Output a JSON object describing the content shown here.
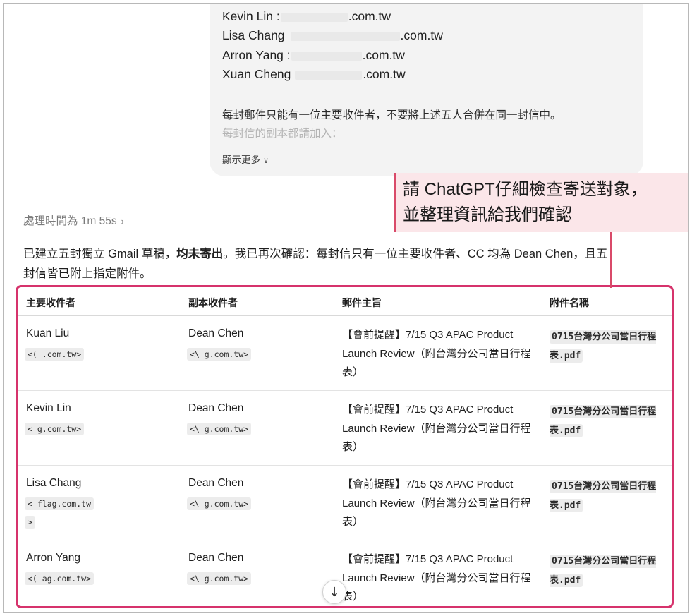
{
  "user_message": {
    "recipients": [
      {
        "name": "Kevin Lin :",
        "email_suffix": ".com.tw"
      },
      {
        "name": "Lisa Chang",
        "email_suffix": ".com.tw"
      },
      {
        "name": "Arron Yang :",
        "email_suffix": ".com.tw"
      },
      {
        "name": "Xuan Cheng",
        "email_suffix": ".com.tw"
      }
    ],
    "paragraph": "每封郵件只能有一位主要收件者，不要將上述五人合併在同一封信中。",
    "faded_line": "每封信的副本都請加入：",
    "show_more": "顯示更多",
    "show_more_icon": "chevron-down-icon"
  },
  "annotation": {
    "line1": "請 ChatGPT仔細檢查寄送對象，",
    "line2": "並整理資訊給我們確認",
    "color": "#d94a69"
  },
  "thinking_time": "處理時間為 1m 55s",
  "reply": {
    "part1": "已建立五封獨立 Gmail 草稿，",
    "bold": "均未寄出",
    "part2": "。我已再次確認：每封信只有一位主要收件者、CC 均為 Dean Chen，且五封信皆已附上指定附件。"
  },
  "table": {
    "headers": [
      "主要收件者",
      "副本收件者",
      "郵件主旨",
      "附件名稱"
    ],
    "rows": [
      {
        "to_name": "Kuan Liu",
        "to_email": "<(         .com.tw>",
        "cc_name": "Dean Chen",
        "cc_email": "<\\         g.com.tw>",
        "subject": "【會前提醒】7/15 Q3 APAC Product Launch Review（附台灣分公司當日行程表）",
        "attachment": "0715台灣分公司當日行程表.pdf"
      },
      {
        "to_name": "Kevin Lin",
        "to_email": "<          g.com.tw>",
        "cc_name": "Dean Chen",
        "cc_email": "<\\         g.com.tw>",
        "subject": "【會前提醒】7/15 Q3 APAC Product Launch Review（附台灣分公司當日行程表）",
        "attachment": "0715台灣分公司當日行程表.pdf"
      },
      {
        "to_name": "Lisa Chang",
        "to_email": "<          flag.com.tw",
        "to_email_2": ">",
        "cc_name": "Dean Chen",
        "cc_email": "<\\         g.com.tw>",
        "subject": "【會前提醒】7/15 Q3 APAC Product Launch Review（附台灣分公司當日行程表）",
        "attachment": "0715台灣分公司當日行程表.pdf"
      },
      {
        "to_name": "Arron Yang",
        "to_email": "<(        ag.com.tw>",
        "cc_name": "Dean Chen",
        "cc_email": "<\\         g.com.tw>",
        "subject": "【會前提醒】7/15 Q3 APAC Product Launch Review（附台灣分公司當日行程表）",
        "attachment": "0715台灣分公司當日行程表.pdf"
      }
    ],
    "border_color": "#d6336c"
  },
  "scroll_down_icon": "arrow-down-icon"
}
